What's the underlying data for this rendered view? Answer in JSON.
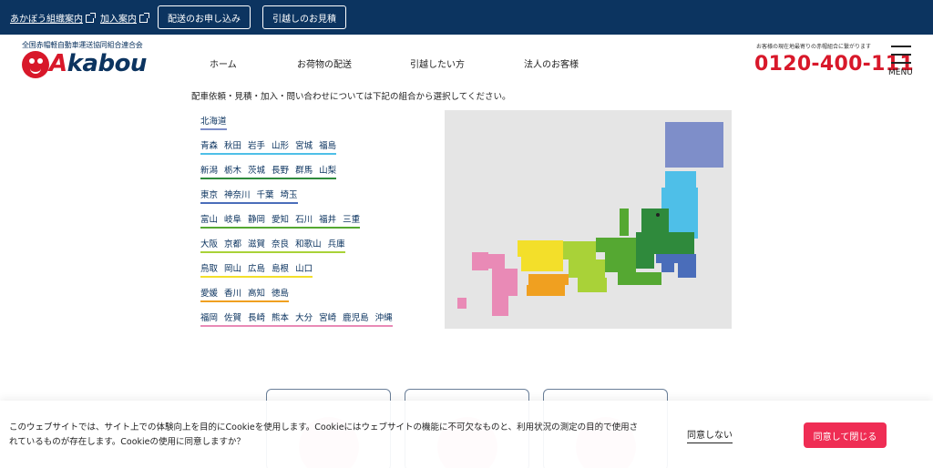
{
  "topbar": {
    "links": [
      "あかぼう組織案内",
      "加入案内"
    ],
    "buttons": [
      "配送のお申し込み",
      "引越しのお見積"
    ]
  },
  "header": {
    "org_name": "全国赤帽軽自動車運送協同組合連合会",
    "logo_text": "kabou",
    "logo_initial": "A",
    "nav": [
      "ホーム",
      "お荷物の配送",
      "引越したい方",
      "法人のお客様"
    ],
    "phone_note": "お客様の現在地最寄りの赤帽組合に繋がります",
    "phone": "0120-400-111",
    "menu_label": "MENU"
  },
  "main": {
    "intro": "配車依頼・見積・加入・問い合わせについては下記の組合から選択してください。",
    "regions": [
      {
        "color": "#7e8ec9",
        "prefs": [
          "北海道"
        ]
      },
      {
        "color": "#4ebfe8",
        "prefs": [
          "青森",
          "秋田",
          "岩手",
          "山形",
          "宮城",
          "福島"
        ]
      },
      {
        "color": "#2f8a3c",
        "prefs": [
          "新潟",
          "栃木",
          "茨城",
          "長野",
          "群馬",
          "山梨"
        ]
      },
      {
        "color": "#4a6dba",
        "prefs": [
          "東京",
          "神奈川",
          "千葉",
          "埼玉"
        ]
      },
      {
        "color": "#55a832",
        "prefs": [
          "富山",
          "岐阜",
          "静岡",
          "愛知",
          "石川",
          "福井",
          "三重"
        ]
      },
      {
        "color": "#a9d238",
        "prefs": [
          "大阪",
          "京都",
          "滋賀",
          "奈良",
          "和歌山",
          "兵庫"
        ]
      },
      {
        "color": "#f3df2a",
        "prefs": [
          "鳥取",
          "岡山",
          "広島",
          "島根",
          "山口"
        ]
      },
      {
        "color": "#f0a020",
        "prefs": [
          "愛媛",
          "香川",
          "高知",
          "徳島"
        ]
      },
      {
        "color": "#e98ab6",
        "prefs": [
          "福岡",
          "佐賀",
          "長崎",
          "熊本",
          "大分",
          "宮崎",
          "鹿児島",
          "沖縄"
        ]
      }
    ]
  },
  "cookie": {
    "line1": "このウェブサイトでは、サイト上での体験向上を目的にCookieを使用します。Cookieにはウェブサイトの機能に不可欠なものと、利用状況の測定の目的で使用さ",
    "line2": "れているものが存在します。Cookieの使用に同意しますか？",
    "decline": "同意しない",
    "accept": "同意して閉じる"
  },
  "colors": {
    "navy": "#0c3460",
    "brand_red": "#d8182a",
    "accept_pink": "#ef2d54"
  },
  "icons": [
    "external-link-icon",
    "menu-icon",
    "box-icon",
    "truck-icon",
    "mail-icon"
  ]
}
